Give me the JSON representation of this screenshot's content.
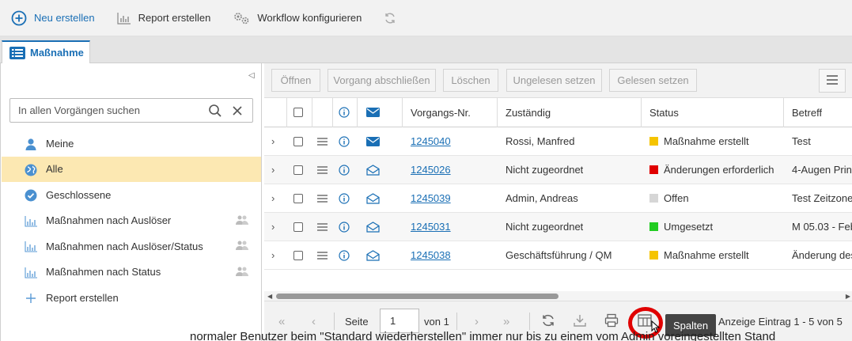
{
  "toolbar": {
    "new_label": "Neu erstellen",
    "report_label": "Report erstellen",
    "workflow_label": "Workflow konfigurieren"
  },
  "tab": {
    "label": "Maßnahme"
  },
  "sidebar": {
    "search_placeholder": "In allen Vorgängen suchen",
    "items": [
      {
        "label": "Meine",
        "icon": "user-icon"
      },
      {
        "label": "Alle",
        "icon": "globe-icon",
        "active": true
      },
      {
        "label": "Geschlossene",
        "icon": "check-circle-icon"
      },
      {
        "label": "Maßnahmen nach Auslöser",
        "icon": "bar-chart-icon",
        "shared": true
      },
      {
        "label": "Maßnahmen nach Auslöser/Status",
        "icon": "bar-chart-icon",
        "shared": true
      },
      {
        "label": "Maßnahmen nach Status",
        "icon": "bar-chart-icon",
        "shared": true
      },
      {
        "label": "Report erstellen",
        "icon": "plus-icon"
      }
    ]
  },
  "actions": {
    "open": "Öffnen",
    "close_case": "Vorgang abschließen",
    "delete": "Löschen",
    "mark_unread": "Ungelesen setzen",
    "mark_read": "Gelesen setzen"
  },
  "grid": {
    "columns": [
      "Vorgangs-Nr.",
      "Zuständig",
      "Status",
      "Betreff"
    ],
    "rows": [
      {
        "id": "1245040",
        "assignee": "Rossi, Manfred",
        "status": "Maßnahme erstellt",
        "status_color": "#f5c400",
        "subject": "Test",
        "read": false
      },
      {
        "id": "1245026",
        "assignee": "Nicht zugeordnet",
        "status": "Änderungen erforderlich",
        "status_color": "#e00000",
        "subject": "4-Augen Prin",
        "read": true
      },
      {
        "id": "1245039",
        "assignee": "Admin, Andreas",
        "status": "Offen",
        "status_color": "#d6d6d6",
        "subject": "Test Zeitzone",
        "read": true
      },
      {
        "id": "1245031",
        "assignee": "Nicht zugeordnet",
        "status": "Umgesetzt",
        "status_color": "#22cc22",
        "subject": "M 05.03 - Feb",
        "read": true
      },
      {
        "id": "1245038",
        "assignee": "Geschäftsführung / QM",
        "status": "Maßnahme erstellt",
        "status_color": "#f5c400",
        "subject": "Änderung des",
        "read": true
      }
    ]
  },
  "pager": {
    "page_label": "Seite",
    "page_value": "1",
    "of_label": "von 1",
    "tooltip": "Spalten",
    "summary": "Anzeige Eintrag 1 - 5 von 5"
  },
  "background_text": "normaler Benutzer beim \"Standard wiederherstellen\" immer nur bis zu einem vom Admin voreingestellten Stand"
}
